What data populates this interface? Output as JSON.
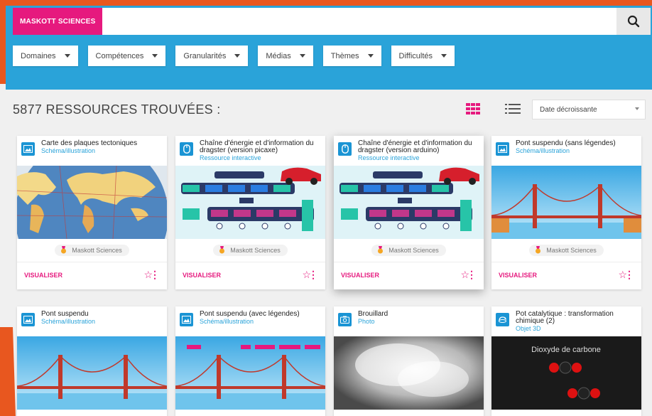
{
  "header": {
    "brand": "MASKOTT SCIENCES",
    "search": {
      "value": "",
      "placeholder": ""
    },
    "search_icon": "search-icon",
    "filters": [
      "Domaines",
      "Compétences",
      "Granularités",
      "Médias",
      "Thèmes",
      "Difficultés"
    ]
  },
  "results": {
    "title": "5877 RESSOURCES TROUVÉES :",
    "sort": "Date décroissante",
    "view_icons": [
      "grid-view-icon",
      "list-view-icon"
    ],
    "accent": "#e6197e",
    "header_color": "#2aa3d9"
  },
  "cards": [
    {
      "title": "Carte des plaques tectoniques",
      "subtitle": "Schéma/illustration",
      "source": "Maskott Sciences",
      "action": "VISUALISER",
      "icon": "image-icon"
    },
    {
      "title": "Chaîne d'énergie et d'information du dragster (version picaxe)",
      "subtitle": "Ressource interactive",
      "source": "Maskott Sciences",
      "action": "VISUALISER",
      "icon": "mouse-icon"
    },
    {
      "title": "Chaîne d'énergie et d'information du dragster (version arduino)",
      "subtitle": "Ressource interactive",
      "source": "Maskott Sciences",
      "action": "VISUALISER",
      "icon": "mouse-icon"
    },
    {
      "title": "Pont suspendu (sans légendes)",
      "subtitle": "Schéma/illustration",
      "source": "Maskott Sciences",
      "action": "VISUALISER",
      "icon": "image-icon"
    },
    {
      "title": "Pont suspendu",
      "subtitle": "Schéma/illustration",
      "icon": "image-icon"
    },
    {
      "title": "Pont suspendu (avec légendes)",
      "subtitle": "Schéma/illustration",
      "icon": "image-icon"
    },
    {
      "title": "Brouillard",
      "subtitle": "Photo",
      "icon": "camera-icon"
    },
    {
      "title": "Pot catalytique : transformation chimique (2)",
      "subtitle": "Objet 3D",
      "icon": "3d-object-icon",
      "thumb_text": "Dioxyde de carbone"
    }
  ]
}
